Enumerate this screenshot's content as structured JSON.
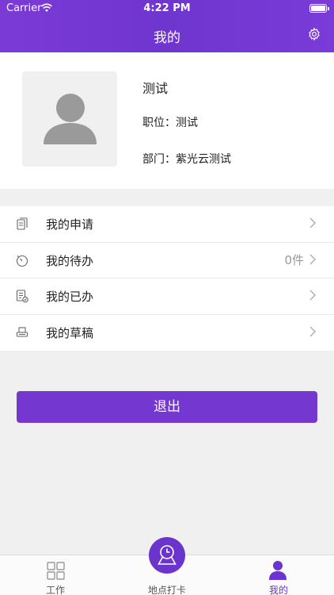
{
  "status": {
    "carrier": "Carrier",
    "time": "4:22 PM"
  },
  "header": {
    "title": "我的",
    "settings_icon": "gear-icon"
  },
  "profile": {
    "name": "测试",
    "position_label": "职位：",
    "position": "测试",
    "department_label": "部门：",
    "department": "紫光云测试",
    "avatar_icon": "user-silhouette-icon"
  },
  "menu": {
    "items": [
      {
        "label": "我的申请",
        "icon": "application-icon",
        "count": ""
      },
      {
        "label": "我的待办",
        "icon": "timer-icon",
        "count": "0件"
      },
      {
        "label": "我的已办",
        "icon": "done-document-icon",
        "count": ""
      },
      {
        "label": "我的草稿",
        "icon": "draft-printer-icon",
        "count": ""
      }
    ]
  },
  "logout": {
    "label": "退出"
  },
  "tabbar": {
    "tabs": [
      {
        "label": "工作",
        "icon": "grid-icon",
        "active": false
      },
      {
        "label": "地点打卡",
        "icon": "location-clock-icon",
        "active": false
      },
      {
        "label": "我的",
        "icon": "person-icon",
        "active": true
      }
    ]
  },
  "colors": {
    "accent": "#7437cf",
    "background": "#f0f0f0"
  }
}
